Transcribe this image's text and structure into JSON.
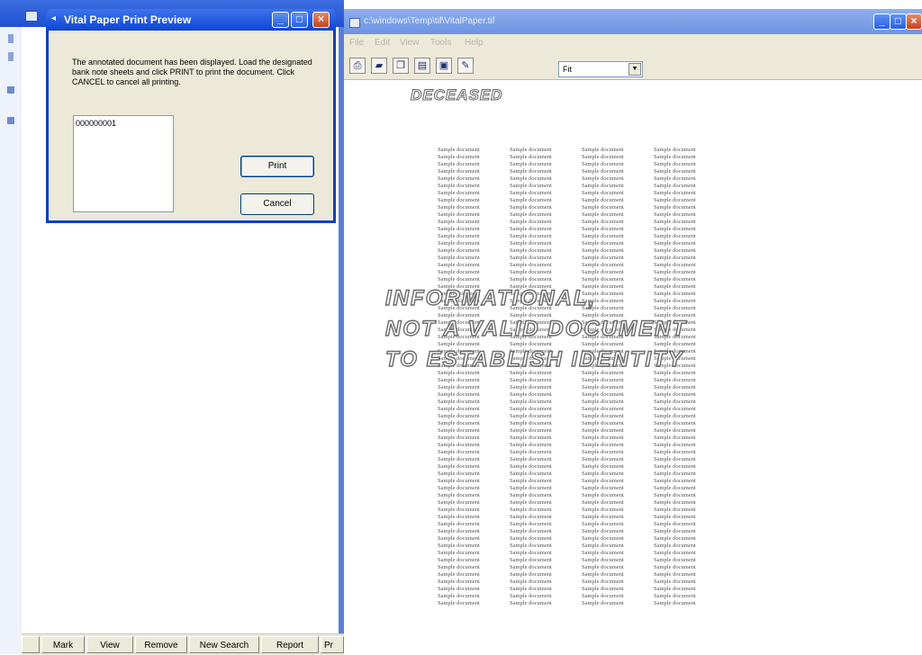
{
  "back_window": {
    "buttons": [
      "",
      "Mark",
      "View",
      "Remove",
      "New Search",
      "Report",
      "Pr"
    ]
  },
  "dialog": {
    "title": "Vital Paper Print Preview",
    "message": "The annotated document has been displayed. Load the designated bank note sheets and click PRINT to print the document. Click CANCEL to cancel all printing.",
    "list_items": [
      "000000001"
    ],
    "print_label": "Print",
    "cancel_label": "Cancel",
    "window_buttons": [
      "_",
      "□",
      "×"
    ]
  },
  "viewer": {
    "title": "c:\\windows\\Temp\\tif\\VitalPaper.tif",
    "menu": [
      "File",
      "Edit",
      "View",
      "Tools",
      "Help"
    ],
    "zoom_value": "Fit",
    "toolbar_icons": [
      "printer-icon",
      "save-icon",
      "copy-icon",
      "page-icon",
      "export-icon",
      "annotate-icon"
    ],
    "window_buttons": [
      "_",
      "□",
      "×"
    ]
  },
  "document": {
    "stamp": "DECEASED",
    "sample_text": "Sample document",
    "sample_rows": 64,
    "sample_cols": 4,
    "watermark_lines": [
      "INFORMATIONAL,",
      "NOT A VALID DOCUMENT",
      "TO ESTABLISH IDENTITY"
    ]
  }
}
